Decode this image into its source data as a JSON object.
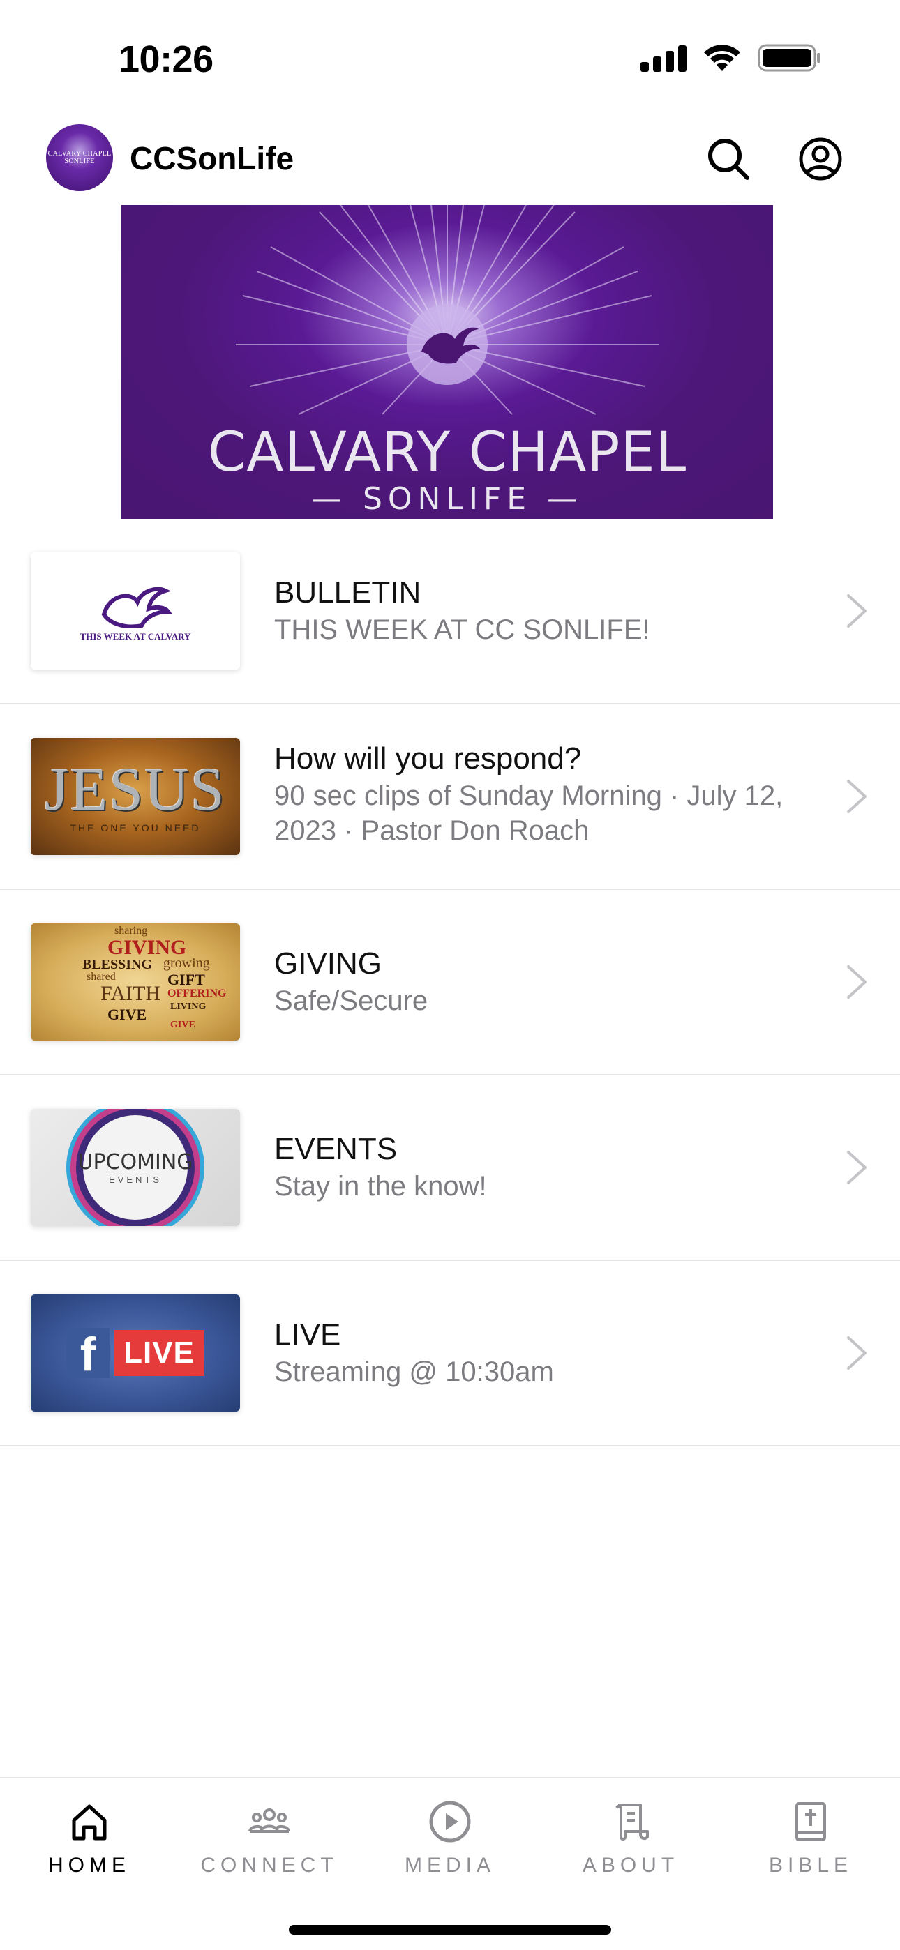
{
  "status_bar": {
    "time": "10:26"
  },
  "header": {
    "title": "CCSonLife",
    "logo_text": "CALVARY CHAPEL SONLIFE"
  },
  "banner": {
    "title": "CALVARY CHAPEL",
    "subtitle": "— SONLIFE —"
  },
  "feed": [
    {
      "title": "BULLETIN",
      "subtitle": "THIS WEEK AT CC SONLIFE!",
      "thumb_caption": "THIS WEEK AT CALVARY"
    },
    {
      "title": "How will you respond?",
      "subtitle": "90 sec clips of Sunday Morning · July 12, 2023 · Pastor Don Roach",
      "thumb_word": "JESUS",
      "thumb_sub": "THE ONE YOU NEED"
    },
    {
      "title": "GIVING",
      "subtitle": "Safe/Secure"
    },
    {
      "title": "EVENTS",
      "subtitle": "Stay in the know!",
      "thumb_main": "UPCOMING",
      "thumb_sub": "EVENTS"
    },
    {
      "title": "LIVE",
      "subtitle": "Streaming @ 10:30am",
      "thumb_badge": "LIVE",
      "thumb_fb": "f"
    }
  ],
  "giving_thumb_words": [
    "GIVING",
    "sharing",
    "BLESSING",
    "growing",
    "GIFT",
    "FAITH",
    "GIVE",
    "OFFERING",
    "LIVING",
    "shared",
    "GIVE"
  ],
  "tabs": [
    {
      "label": "HOME",
      "icon": "home-icon",
      "active": true
    },
    {
      "label": "CONNECT",
      "icon": "people-icon",
      "active": false
    },
    {
      "label": "MEDIA",
      "icon": "play-icon",
      "active": false
    },
    {
      "label": "ABOUT",
      "icon": "scroll-icon",
      "active": false
    },
    {
      "label": "BIBLE",
      "icon": "bible-icon",
      "active": false
    }
  ],
  "colors": {
    "brand_purple": "#4a1672",
    "tab_inactive": "#8e8e93",
    "divider": "#e4e4e6"
  }
}
